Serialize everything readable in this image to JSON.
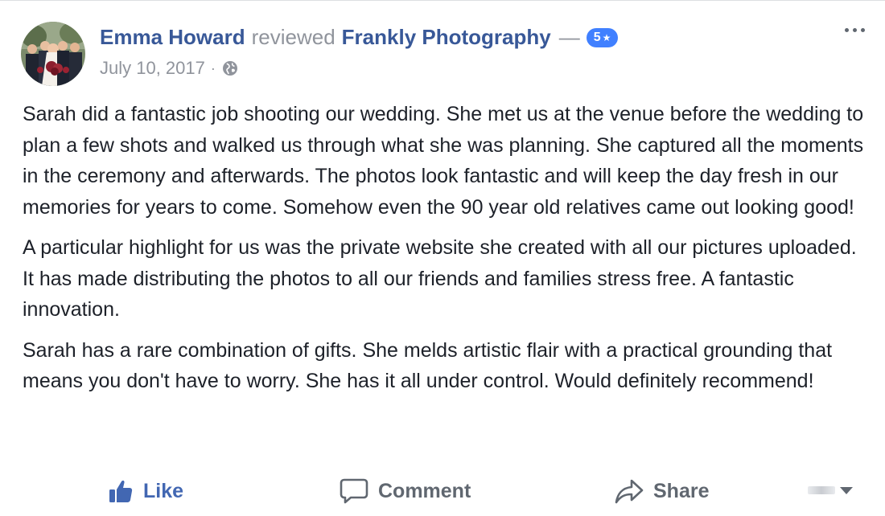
{
  "post": {
    "author_name": "Emma Howard",
    "action_text": "reviewed",
    "page_name": "Frankly Photography",
    "dash": "—",
    "rating": "5",
    "date": "July 10, 2017",
    "separator": "·",
    "privacy_icon": "globe-icon",
    "more_icon": "more-options-icon"
  },
  "review": {
    "paragraphs": [
      "Sarah did a fantastic job shooting our wedding. She met us at the venue before the wedding to plan a few shots and walked us through what she was planning. She captured all the moments in the ceremony and afterwards. The photos look fantastic and will keep the day fresh in our memories for years to come. Somehow even the 90 year old relatives came out looking good!",
      "A particular highlight for us was the private website she created with all our pictures uploaded. It has made distributing the photos to all our friends and families stress free. A fantastic innovation.",
      "Sarah has a rare combination of gifts. She melds artistic flair with a practical grounding that means you don't have to worry. She has it all under control. Would definitely recommend!"
    ]
  },
  "actions": {
    "like_label": "Like",
    "comment_label": "Comment",
    "share_label": "Share"
  },
  "colors": {
    "link_blue": "#385898",
    "like_blue": "#4267b2",
    "badge_blue": "#4080ff",
    "meta_gray": "#90949c",
    "text": "#1d2129"
  }
}
